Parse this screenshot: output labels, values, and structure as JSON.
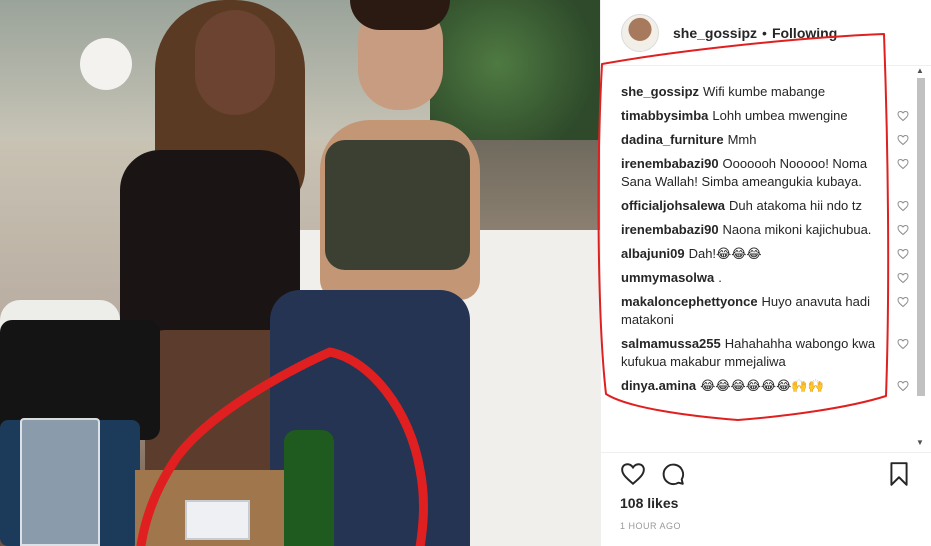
{
  "post": {
    "username": "she_gossipz",
    "separator": "•",
    "follow_status": "Following",
    "likes": "108 likes",
    "time": "1 HOUR AGO"
  },
  "comments": [
    {
      "user": "she_gossipz",
      "text": "Wifi kumbe mabange",
      "heart": false
    },
    {
      "user": "timabbysimba",
      "text": "Lohh umbea mwengine",
      "heart": true
    },
    {
      "user": "dadina_furniture",
      "text": "Mmh",
      "heart": true
    },
    {
      "user": "irenembabazi90",
      "text": "Ooooooh Nooooo! Noma Sana Wallah! Simba ameangukia kubaya.",
      "heart": true
    },
    {
      "user": "officialjohsalewa",
      "text": "Duh atakoma hii ndo tz",
      "heart": true
    },
    {
      "user": "irenembabazi90",
      "text": "Naona mikoni kajichubua.",
      "heart": true
    },
    {
      "user": "albajuni09",
      "text": "Dah!😂😂😂",
      "heart": true
    },
    {
      "user": "ummymasolwa",
      "text": ".",
      "heart": true
    },
    {
      "user": "makaloncephettyonce",
      "text": "Huyo anavuta hadi matakoni",
      "heart": true
    },
    {
      "user": "salmamussa255",
      "text": "Hahahahha wabongo kwa kufukua makabur mmejaliwa",
      "heart": true
    },
    {
      "user": "dinya.amina",
      "text": "😂😂😂😂😂😂🙌🙌",
      "heart": true
    }
  ],
  "icons": {
    "like": "heart-icon",
    "comment": "comment-icon",
    "save": "bookmark-icon",
    "comment_like": "heart-icon"
  },
  "colors": {
    "annotation_red": "#e02020",
    "text": "#262626",
    "muted": "#999999"
  }
}
